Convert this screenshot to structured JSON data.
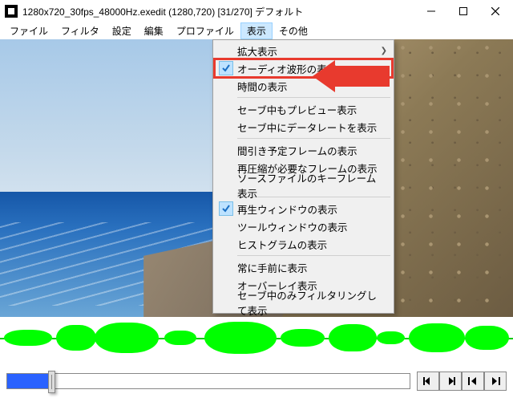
{
  "title": "1280x720_30fps_48000Hz.exedit (1280,720)  [31/270]  デフォルト",
  "menubar": [
    "ファイル",
    "フィルタ",
    "設定",
    "編集",
    "プロファイル",
    "表示",
    "その他"
  ],
  "menubar_active_index": 5,
  "dropdown": {
    "groups": [
      [
        {
          "label": "拡大表示",
          "checked": false,
          "submenu": true,
          "highlight": false
        },
        {
          "label": "オーディオ波形の表示",
          "checked": true,
          "submenu": false,
          "highlight": true
        },
        {
          "label": "時間の表示",
          "checked": false,
          "submenu": false,
          "highlight": false
        }
      ],
      [
        {
          "label": "セーブ中もプレビュー表示",
          "checked": false,
          "submenu": false,
          "highlight": false
        },
        {
          "label": "セーブ中にデータレートを表示",
          "checked": false,
          "submenu": false,
          "highlight": false
        }
      ],
      [
        {
          "label": "間引き予定フレームの表示",
          "checked": false,
          "submenu": false,
          "highlight": false
        },
        {
          "label": "再圧縮が必要なフレームの表示",
          "checked": false,
          "submenu": false,
          "highlight": false
        },
        {
          "label": "ソースファイルのキーフレーム表示",
          "checked": false,
          "submenu": false,
          "highlight": false
        }
      ],
      [
        {
          "label": "再生ウィンドウの表示",
          "checked": true,
          "submenu": false,
          "highlight": false
        },
        {
          "label": "ツールウィンドウの表示",
          "checked": false,
          "submenu": false,
          "highlight": false
        },
        {
          "label": "ヒストグラムの表示",
          "checked": false,
          "submenu": false,
          "highlight": false
        }
      ],
      [
        {
          "label": "常に手前に表示",
          "checked": false,
          "submenu": false,
          "highlight": false
        },
        {
          "label": "オーバーレイ表示",
          "checked": false,
          "submenu": false,
          "highlight": false
        },
        {
          "label": "セーブ中のみフィルタリングして表示",
          "checked": false,
          "submenu": false,
          "highlight": false
        }
      ]
    ]
  },
  "timeline": {
    "current_frame": 31,
    "total_frames": 270,
    "progress_pct": 11
  },
  "transport_icons": [
    "prev-frame",
    "next-frame",
    "first-frame",
    "last-frame"
  ]
}
